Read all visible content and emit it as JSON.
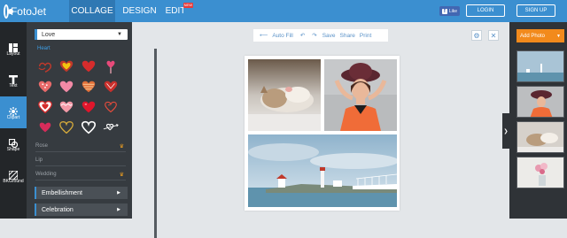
{
  "header": {
    "logo_text": "FotoJet",
    "tabs": [
      {
        "label": "COLLAGE",
        "active": true
      },
      {
        "label": "DESIGN",
        "active": false
      },
      {
        "label": "EDIT",
        "active": false
      }
    ],
    "new_badge": "NEW",
    "fb_like": "Like",
    "login": "LOGIN",
    "signup": "SIGN UP"
  },
  "rail": {
    "items": [
      {
        "label": "Layout",
        "icon": "layout-icon"
      },
      {
        "label": "Text",
        "icon": "text-icon"
      },
      {
        "label": "Clipart",
        "icon": "clipart-icon",
        "active": true
      },
      {
        "label": "Shape",
        "icon": "shape-icon"
      },
      {
        "label": "BKGround",
        "icon": "background-icon"
      }
    ]
  },
  "panel": {
    "category": "Love",
    "subcategory": "Heart",
    "sections": [
      {
        "label": "Rose",
        "premium": true
      },
      {
        "label": "Lip",
        "premium": false
      },
      {
        "label": "Wedding",
        "premium": true
      }
    ],
    "accordions": [
      "Embellishment",
      "Celebration"
    ]
  },
  "toolbar": {
    "auto_fill": "Auto Fill",
    "save": "Save",
    "share": "Share",
    "print": "Print"
  },
  "right_panel": {
    "add_photo": "Add Photo"
  },
  "colors": {
    "brand": "#3b8fd0",
    "accent": "#f28a1c",
    "panel": "#363b40"
  }
}
